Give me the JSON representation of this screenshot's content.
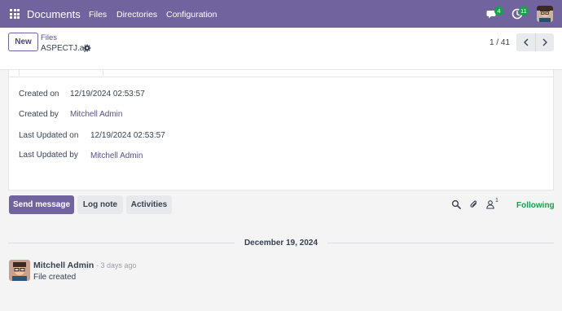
{
  "navbar": {
    "app_title": "Documents",
    "menu": [
      "Files",
      "Directories",
      "Configuration"
    ],
    "message_count": "4",
    "activity_count": "11"
  },
  "control_panel": {
    "new_label": "New",
    "breadcrumb_parent": "Files",
    "record_name": "ASPECTJ.aj",
    "pager_value": "1 / 41"
  },
  "fields": [
    {
      "label": "Created on",
      "value": "12/19/2024 02:53:57"
    },
    {
      "label": "Created by",
      "value": "Mitchell Admin"
    },
    {
      "label": "Last Updated on",
      "value": "12/19/2024 02:53:57"
    },
    {
      "label": "Last Updated by",
      "value": "Mitchell Admin"
    }
  ],
  "chatter": {
    "send_message": "Send message",
    "log_note": "Log note",
    "activities": "Activities",
    "follower_count": "1",
    "following": "Following",
    "date_separator": "December 19, 2024",
    "message": {
      "author": "Mitchell Admin",
      "date": "- 3 days ago",
      "body": "File created"
    }
  },
  "colors": {
    "brand": "#71639e",
    "success": "#17a24a",
    "link": "#5a4f86"
  },
  "icons": [
    "apps-icon",
    "chat-icon",
    "clock-icon",
    "gear-icon",
    "chevron-left-icon",
    "chevron-right-icon",
    "search-icon",
    "paperclip-icon",
    "user-icon"
  ]
}
